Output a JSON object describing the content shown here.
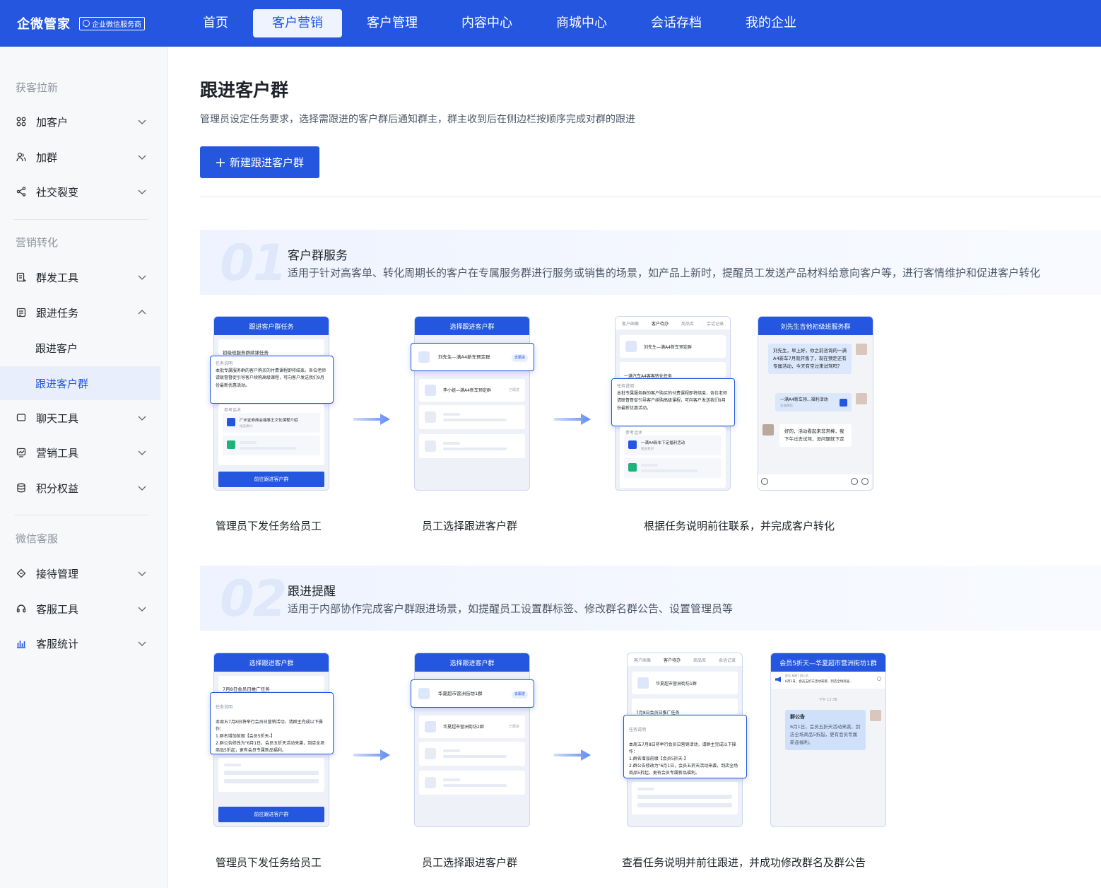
{
  "topbar": {
    "brand_name": "企微管家",
    "brand_badge": "企业微信服务商",
    "nav": [
      "首页",
      "客户营销",
      "客户管理",
      "内容中心",
      "商城中心",
      "会话存档",
      "我的企业"
    ],
    "active_nav": "客户营销"
  },
  "sidebar": {
    "group1": "获客拉新",
    "group2": "营销转化",
    "group3": "微信客服",
    "items": {
      "add_customer": "加客户",
      "add_group": "加群",
      "social_fission": "社交裂变",
      "group_send": "群发工具",
      "follow_task": "跟进任务",
      "follow_customer": "跟进客户",
      "follow_group": "跟进客户群",
      "chat_tools": "聊天工具",
      "marketing_tools": "营销工具",
      "points_rights": "积分权益",
      "reception_mgmt": "接待管理",
      "service_tools": "客服工具",
      "service_stats": "客服统计"
    }
  },
  "main": {
    "title": "跟进客户群",
    "description": "管理员设定任务要求，选择需跟进的客户群后通知群主，群主收到后在侧边栏按顺序完成对群的跟进",
    "new_button": "新建跟进客户群",
    "sections": [
      {
        "num": "01",
        "title": "客户群服务",
        "desc": "适用于针对高客单、转化周期长的客户在专属服务群进行服务或销售的场景，如产品上新时，提醒员工发送产品材料给意向客户等，进行客情维护和促进客户转化",
        "captions": [
          "管理员下发任务给员工",
          "员工选择跟进客户群",
          "根据任务说明前往联系，并完成客户转化"
        ],
        "p1": {
          "header": "跟进客户群任务",
          "task_title": "初级班服务群续课任务",
          "popup_label": "任务说明",
          "popup_text": "本批专属服务群的客户购买的付费课程即将结束。各位老师请联督督促引导客户续购高级课程，可向客户发送我们9月份最新优惠活动。",
          "ref_label": "参考话术",
          "ref_item": "广州证券商会端事王文化课程介绍",
          "ref_sub": "推送素材",
          "button": "前往跟进客户群"
        },
        "p2": {
          "header": "选择跟进客户群",
          "row1": "刘先生—满A4新车预定群",
          "row1_tag": "去跟进",
          "row2": "李小姐—满A4新车预定群",
          "row2_tag": "已跟进"
        },
        "p3": {
          "tabs": [
            "客户画像",
            "客户待办",
            "商品库",
            "会话记录"
          ],
          "row1": "刘先生—满A4新车预定群",
          "task_title": "一满汽车A4客客转化任务",
          "popup_label": "任务说明",
          "popup_text": "本批专属服务群的客户购买的付费课程即将结束，各位老师请联督督促引导客户续购高级课程，可向客户发送我们9月份最新优惠活动。",
          "ref_label": "参考话术",
          "ref_item": "一满A4新车下定福利活动",
          "ref_sub": "推送素材"
        },
        "p4": {
          "header": "刘先生吉他初级班服务群",
          "msg1": "刘先生，早上好，你之前咨询的一满A4新车7月就开售了，现在预定还有专属活动，今天有空过来试驾吗？",
          "msg2": "一满A4新车预...福利活动",
          "msg2_sub": "企业微信",
          "msg3": "好的，活动看起来非常棒，我下午过去试驾，没问题就下定"
        }
      },
      {
        "num": "02",
        "title": "跟进提醒",
        "desc": "适用于内部协作完成客户群跟进场景，如提醒员工设置群标签、修改群名群公告、设置管理员等",
        "captions": [
          "管理员下发任务给员工",
          "员工选择跟进客户群",
          "查看任务说明并前往跟进，并成功修改群名及群公告"
        ],
        "p1": {
          "header": "选择跟进客户群",
          "task_title": "7月8日会员日推广任务",
          "popup_label": "任务说明",
          "popup_text": "本周五7月8日将举行会员日营销活动，请群主完成以下操作：\n1.群名增加前缀【会员5折天-】\n2.群公告修改为\"6月1日，会员五折天活动来袭，到店全场商品5折起，更有会员专属新品福利。",
          "button": "前往跟进客户群"
        },
        "p2": {
          "header": "选择跟进客户群",
          "row1": "华夏超市营洲街坊1群",
          "row1_tag": "去跟进",
          "row2": "华夏超市营洲街坊2群",
          "row2_tag": "已跟进"
        },
        "p3": {
          "tabs": [
            "客户画像",
            "客户待办",
            "商品库",
            "会话记录"
          ],
          "row1": "华夏超市营洲街坊1群",
          "task_title": "7月8日会员日推广任务",
          "popup_label": "任务说明",
          "popup_text": "本周五7月8日将举行会员日营销活动，请群主完成以下操作：\n1.群名增加前缀【会员5折天-】\n2.群公告修改为\"6月1日，会员五折天活动来袭，到店全场商品5折起，更有会员专属新品福利。"
        },
        "p4": {
          "header": "会员5折天—华夏超市营洲街坊1群",
          "notice_small": "群告 每周7 群公告",
          "notice_line": "6月1日，会员五折天活动来袭，到店全场商品...",
          "time": "下午 12:38",
          "bubble_title": "群公告",
          "bubble_text": "6月1日，会员五折天活动来袭，到店全场商品5折起，更有会员专属新品福利。"
        }
      }
    ]
  },
  "colors": {
    "primary": "#2456e0",
    "sidebar_bg": "#f7f8fa",
    "selected_bg": "#e8eefc"
  }
}
